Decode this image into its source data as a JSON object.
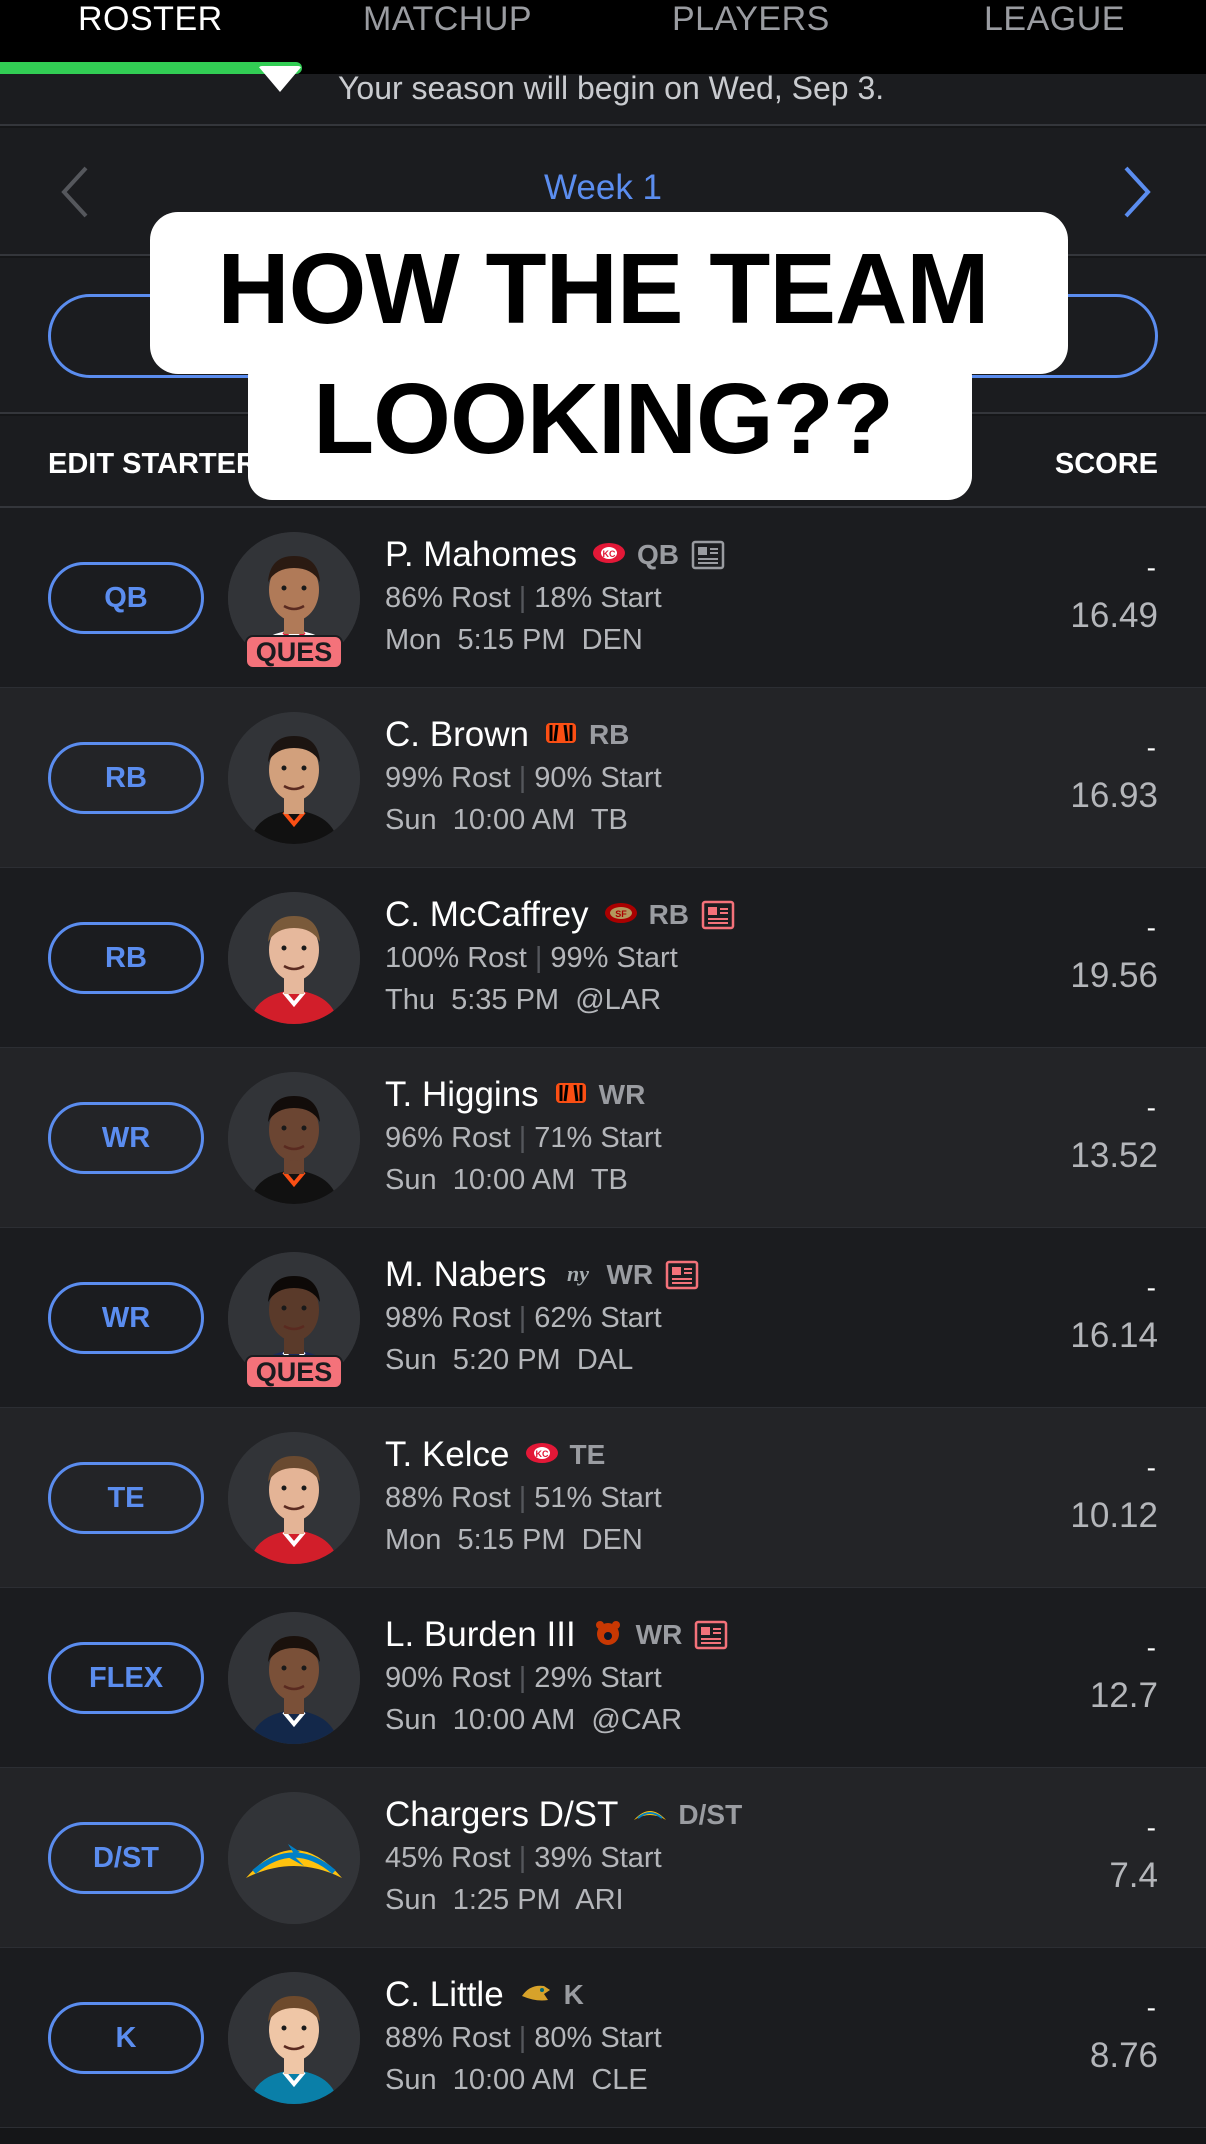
{
  "nav": {
    "tabs": [
      {
        "label": "ROSTER",
        "active": true
      },
      {
        "label": "MATCHUP",
        "active": false
      },
      {
        "label": "PLAYERS",
        "active": false
      },
      {
        "label": "LEAGUE",
        "active": false
      }
    ]
  },
  "notice": {
    "text": "Your season will begin on Wed, Sep 3."
  },
  "week": {
    "label": "Week 1"
  },
  "roster_header": {
    "left": "EDIT STARTERS",
    "right": "SCORE"
  },
  "caption": {
    "line1": "HOW THE TEAM",
    "line2": "LOOKING??"
  },
  "colors": {
    "accent": "#5b8def",
    "active_tab": "#32cd54",
    "ques_badge": "#f4727a"
  },
  "roster": [
    {
      "slot": "QB",
      "name": "P. Mahomes",
      "team_icon": "chiefs-logo-icon",
      "pos": "QB",
      "news": true,
      "rost": "86% Rost",
      "start": "18% Start",
      "game": "Mon  5:15 PM  DEN",
      "score": "-",
      "proj": "16.49",
      "status": "QUES"
    },
    {
      "slot": "RB",
      "name": "C. Brown",
      "team_icon": "bengals-logo-icon",
      "pos": "RB",
      "news": false,
      "rost": "99% Rost",
      "start": "90% Start",
      "game": "Sun  10:00 AM  TB",
      "score": "-",
      "proj": "16.93",
      "status": ""
    },
    {
      "slot": "RB",
      "name": "C. McCaffrey",
      "team_icon": "49ers-logo-icon",
      "pos": "RB",
      "news": true,
      "rost": "100% Rost",
      "start": "99% Start",
      "game": "Thu  5:35 PM  @LAR",
      "score": "-",
      "proj": "19.56",
      "status": ""
    },
    {
      "slot": "WR",
      "name": "T. Higgins",
      "team_icon": "bengals-logo-icon",
      "pos": "WR",
      "news": false,
      "rost": "96% Rost",
      "start": "71% Start",
      "game": "Sun  10:00 AM  TB",
      "score": "-",
      "proj": "13.52",
      "status": ""
    },
    {
      "slot": "WR",
      "name": "M. Nabers",
      "team_icon": "giants-logo-icon",
      "pos": "WR",
      "news": true,
      "rost": "98% Rost",
      "start": "62% Start",
      "game": "Sun  5:20 PM  DAL",
      "score": "-",
      "proj": "16.14",
      "status": "QUES"
    },
    {
      "slot": "TE",
      "name": "T. Kelce",
      "team_icon": "chiefs-logo-icon",
      "pos": "TE",
      "news": false,
      "rost": "88% Rost",
      "start": "51% Start",
      "game": "Mon  5:15 PM  DEN",
      "score": "-",
      "proj": "10.12",
      "status": ""
    },
    {
      "slot": "FLEX",
      "name": "L. Burden III",
      "team_icon": "bears-logo-icon",
      "pos": "WR",
      "news": true,
      "rost": "90% Rost",
      "start": "29% Start",
      "game": "Sun  10:00 AM  @CAR",
      "score": "-",
      "proj": "12.7",
      "status": ""
    },
    {
      "slot": "D/ST",
      "name": "Chargers D/ST",
      "team_icon": "chargers-logo-icon",
      "pos": "D/ST",
      "news": false,
      "rost": "45% Rost",
      "start": "39% Start",
      "game": "Sun  1:25 PM  ARI",
      "score": "-",
      "proj": "7.4",
      "status": ""
    },
    {
      "slot": "K",
      "name": "C. Little",
      "team_icon": "jaguars-logo-icon",
      "pos": "K",
      "news": false,
      "rost": "88% Rost",
      "start": "80% Start",
      "game": "Sun  10:00 AM  CLE",
      "score": "-",
      "proj": "8.76",
      "status": ""
    }
  ]
}
